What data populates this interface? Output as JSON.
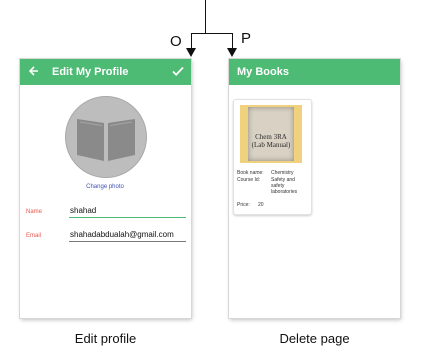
{
  "flow": {
    "left_label": "O",
    "right_label": "P"
  },
  "edit_profile": {
    "appbar": {
      "back_icon": "arrow-left-icon",
      "title": "Edit My Profile",
      "confirm_icon": "check-icon"
    },
    "avatar_icon": "open-book-icon",
    "change_photo": "Change photo",
    "fields": [
      {
        "label": "Name",
        "value": "shahad"
      },
      {
        "label": "Email",
        "value": "shahadabdualah@gmail.com"
      }
    ],
    "caption": "Edit profile",
    "colors": {
      "appbar": "#4dbb74",
      "label": "#e8574c",
      "underline_active": "#4dbb74",
      "link": "#3f51b5"
    }
  },
  "my_books": {
    "appbar": {
      "title": "My Books"
    },
    "books": [
      {
        "cover_text_line1": "Chem 3RA",
        "cover_text_line2": "(Lab Manual)",
        "book_name_label": "Book name:",
        "book_name": "Chemistry",
        "course_id_label": "Course Id:",
        "course_id": "Safety and safety laboratories",
        "price_label": "Price:",
        "price": "20"
      }
    ],
    "caption": "Delete page"
  }
}
